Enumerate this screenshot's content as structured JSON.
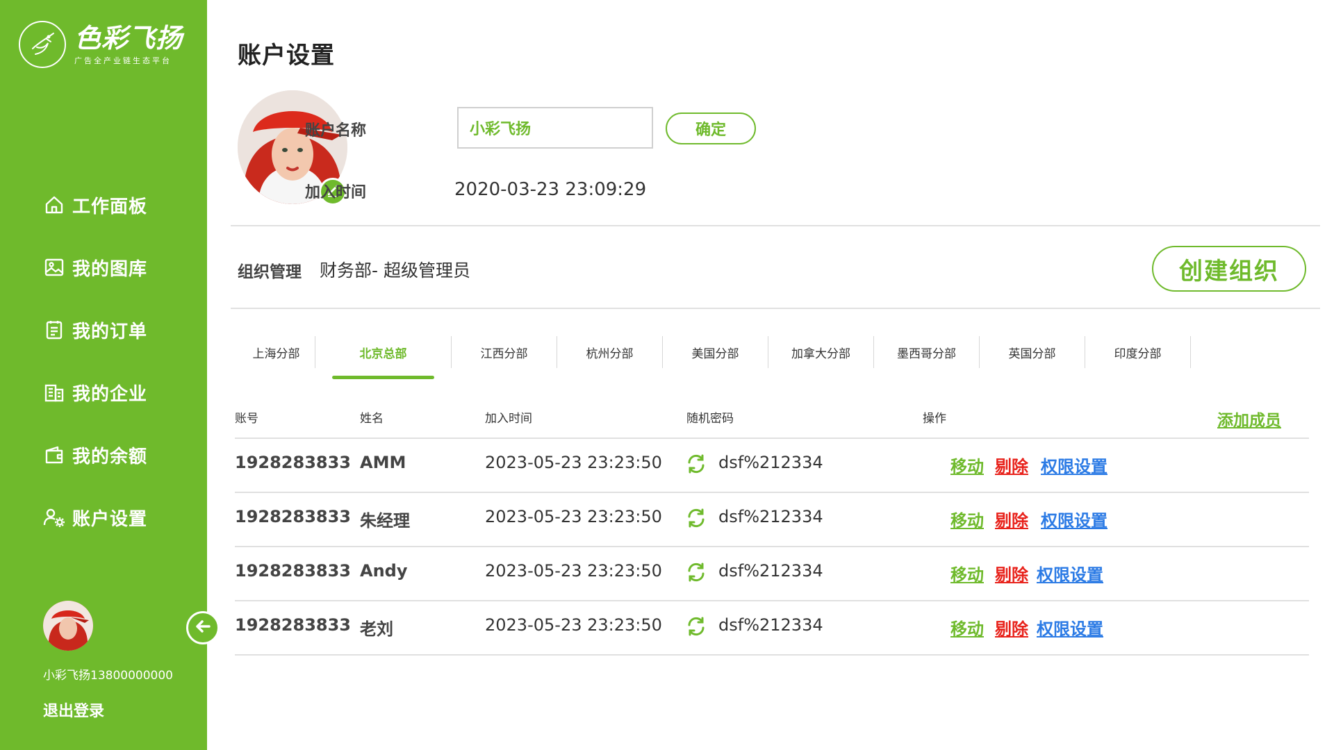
{
  "brand": {
    "name": "色彩飞扬",
    "tagline": "广告全产业链生态平台"
  },
  "sidebar": {
    "items": [
      {
        "label": "工作面板",
        "icon": "home-icon"
      },
      {
        "label": "我的图库",
        "icon": "image-icon"
      },
      {
        "label": "我的订单",
        "icon": "clipboard-icon"
      },
      {
        "label": "我的企业",
        "icon": "building-icon"
      },
      {
        "label": "我的余额",
        "icon": "wallet-icon"
      },
      {
        "label": "账户设置",
        "icon": "user-gear-icon"
      }
    ],
    "user": "小彩飞扬13800000000",
    "logout": "退出登录"
  },
  "page": {
    "title": "账户设置"
  },
  "account": {
    "name_label": "账户名称",
    "name_value": "小彩飞扬",
    "confirm": "确定",
    "join_label": "加入时间",
    "join_time": "2020-03-23 23:09:29"
  },
  "org": {
    "label": "组织管理",
    "value": "财务部- 超级管理员",
    "create": "创建组织"
  },
  "tabs": [
    "上海分部",
    "北京总部",
    "江西分部",
    "杭州分部",
    "美国分部",
    "加拿大分部",
    "墨西哥分部",
    "英国分部",
    "印度分部"
  ],
  "active_tab": "北京总部",
  "table": {
    "headers": [
      "账号",
      "姓名",
      "加入时间",
      "随机密码",
      "操作"
    ],
    "add_member": "添加成员",
    "rows": [
      {
        "account": "1928283833",
        "name": "AMM",
        "time": "2023-05-23 23:23:50",
        "password": "dsf%212334",
        "move": "移动",
        "remove": "剔除",
        "perm": "权限设置"
      },
      {
        "account": "1928283833",
        "name": "朱经理",
        "time": "2023-05-23 23:23:50",
        "password": "dsf%212334",
        "move": "移动",
        "remove": "剔除",
        "perm": "权限设置"
      },
      {
        "account": "1928283833",
        "name": "Andy",
        "time": "2023-05-23 23:23:50",
        "password": "dsf%212334",
        "move": "移动",
        "remove": "剔除",
        "perm": "权限设置"
      },
      {
        "account": "1928283833",
        "name": "老刘",
        "time": "2023-05-23 23:23:50",
        "password": "dsf%212334",
        "move": "移动",
        "remove": "剔除",
        "perm": "权限设置"
      }
    ]
  },
  "colors": {
    "accent": "#6fba2c",
    "danger": "#e8221b",
    "link": "#2c7be5"
  }
}
